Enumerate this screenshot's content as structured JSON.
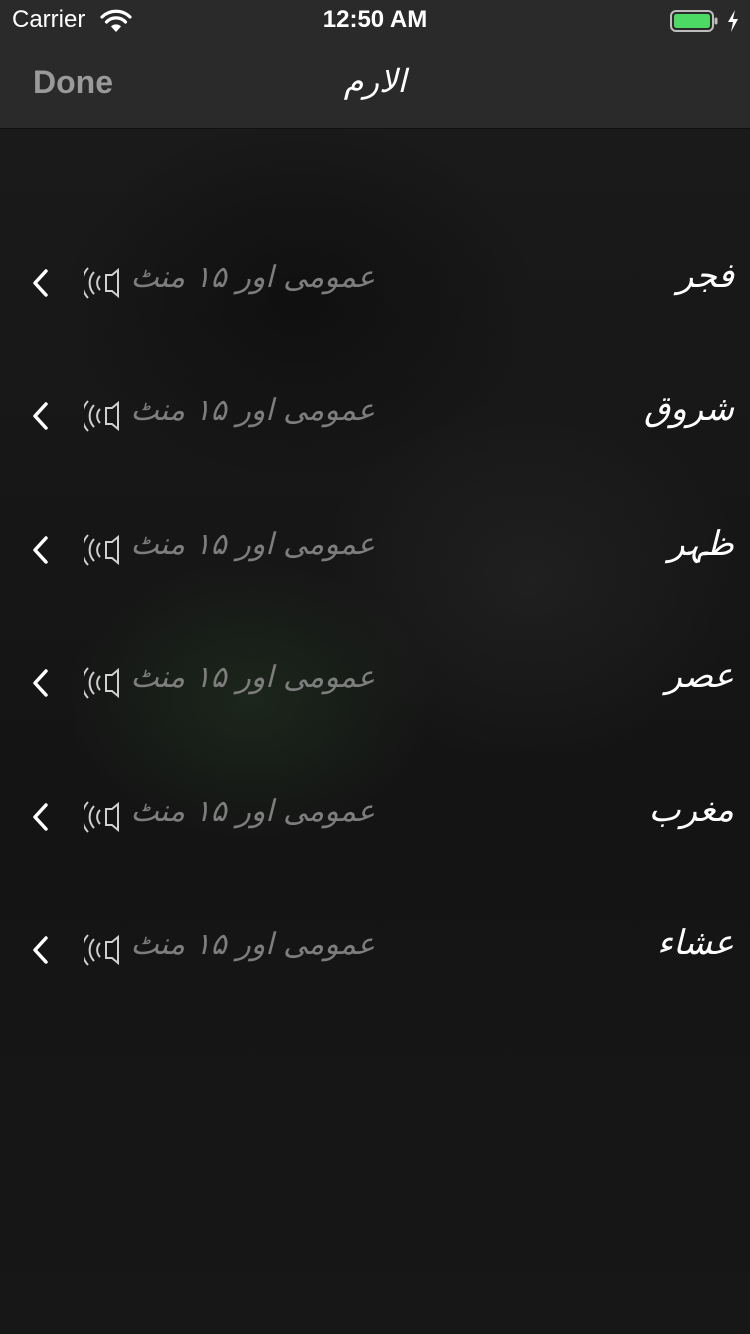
{
  "status_bar": {
    "carrier": "Carrier",
    "time": "12:50 AM",
    "battery_color": "#4cd964"
  },
  "nav": {
    "done_label": "Done",
    "title": "الارم"
  },
  "rows": [
    {
      "name": "فجر",
      "detail": "عمومی اور ۱۵ منٹ",
      "icon": "speaker-icon"
    },
    {
      "name": "شروق",
      "detail": "عمومی اور ۱۵ منٹ",
      "icon": "speaker-icon"
    },
    {
      "name": "ظہر",
      "detail": "عمومی اور ۱۵ منٹ",
      "icon": "speaker-icon"
    },
    {
      "name": "عصر",
      "detail": "عمومی اور ۱۵ منٹ",
      "icon": "speaker-icon"
    },
    {
      "name": "مغرب",
      "detail": "عمومی اور ۱۵ منٹ",
      "icon": "speaker-icon"
    },
    {
      "name": "عشاء",
      "detail": "عمومی اور ۱۵ منٹ",
      "icon": "speaker-icon"
    }
  ]
}
